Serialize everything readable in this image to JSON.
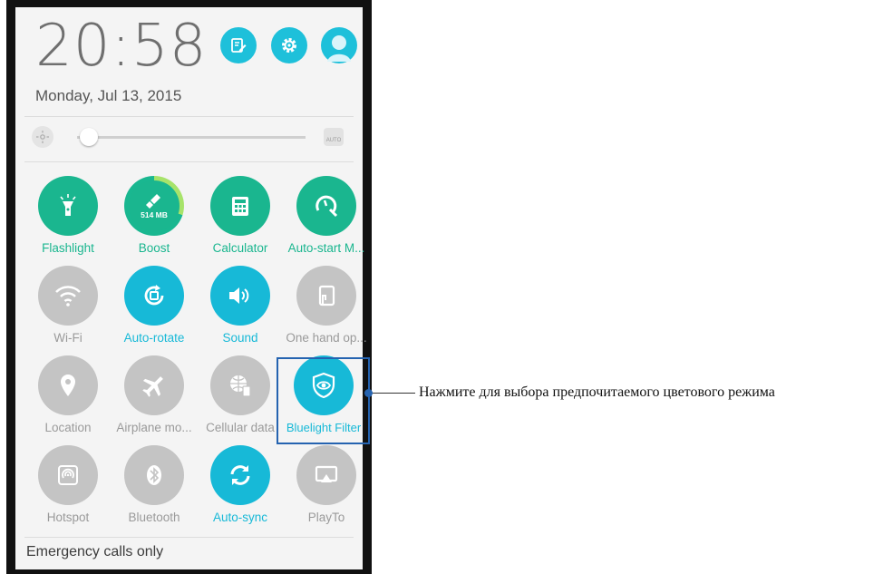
{
  "clock": {
    "time": "20:58",
    "date": "Monday, Jul 13, 2015"
  },
  "top_actions": [
    {
      "icon": "edit-icon"
    },
    {
      "icon": "settings-gear-icon"
    },
    {
      "icon": "user-avatar-icon"
    }
  ],
  "brightness": {
    "level": 0.05,
    "auto_label": "AUTO"
  },
  "tiles": [
    {
      "label": "Flashlight",
      "state": "on",
      "icon": "flashlight-icon",
      "color": "#1ab68f"
    },
    {
      "label": "Boost",
      "state": "on",
      "icon": "broom-icon",
      "badge": "514 MB",
      "color": "#1ab68f"
    },
    {
      "label": "Calculator",
      "state": "on",
      "icon": "calculator-icon",
      "color": "#1ab68f"
    },
    {
      "label": "Auto-start M...",
      "state": "on",
      "icon": "auto-start-icon",
      "color": "#1ab68f"
    },
    {
      "label": "Wi-Fi",
      "state": "off",
      "icon": "wifi-icon"
    },
    {
      "label": "Auto-rotate",
      "state": "on",
      "icon": "auto-rotate-icon",
      "color": "#17b9d7"
    },
    {
      "label": "Sound",
      "state": "on",
      "icon": "sound-icon",
      "color": "#17b9d7"
    },
    {
      "label": "One hand op...",
      "state": "off",
      "icon": "one-hand-icon"
    },
    {
      "label": "Location",
      "state": "off",
      "icon": "location-pin-icon"
    },
    {
      "label": "Airplane mo...",
      "state": "off",
      "icon": "airplane-icon"
    },
    {
      "label": "Cellular data",
      "state": "off",
      "icon": "cellular-data-icon"
    },
    {
      "label": "Bluelight Filter",
      "state": "on",
      "icon": "bluelight-filter-icon",
      "color": "#17b9d7"
    },
    {
      "label": "Hotspot",
      "state": "off",
      "icon": "hotspot-icon"
    },
    {
      "label": "Bluetooth",
      "state": "off",
      "icon": "bluetooth-icon"
    },
    {
      "label": "Auto-sync",
      "state": "on",
      "icon": "sync-icon",
      "color": "#17b9d7"
    },
    {
      "label": "PlayTo",
      "state": "off",
      "icon": "playto-icon"
    }
  ],
  "status": "Emergency calls only",
  "callout": "Нажмите для выбора предпочитаемого цветового режима"
}
